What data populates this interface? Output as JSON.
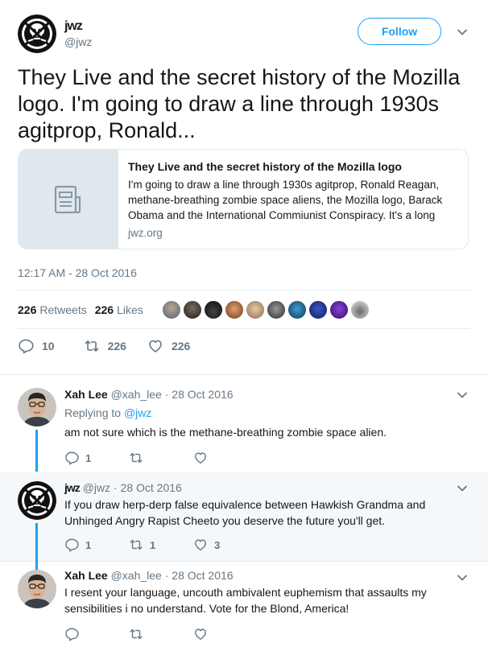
{
  "tweet": {
    "author_name": "jwz",
    "author_handle": "@jwz",
    "follow_label": "Follow",
    "text": "They Live and the secret history of the Mozilla logo. I'm going to draw a line through 1930s agitprop, Ronald...",
    "card": {
      "title": "They Live and the secret history of the Mozilla logo",
      "description": "I'm going to draw a line through 1930s agitprop, Ronald Reagan, methane-breathing zombie space aliens, the Mozilla logo, Barack Obama and the International Commiunist Conspiracy. It's a long",
      "domain": "jwz.org"
    },
    "timestamp": "12:17 AM - 28 Oct 2016",
    "retweets_count": "226",
    "retweets_label": "Retweets",
    "likes_count": "226",
    "likes_label": "Likes",
    "actions": {
      "replies": "10",
      "retweets": "226",
      "likes": "226"
    }
  },
  "replies": [
    {
      "name": "Xah Lee",
      "handle": "@xah_lee",
      "date": "· 28 Oct 2016",
      "replying_prefix": "Replying to",
      "replying_to": "@jwz",
      "text": "am not sure which is the methane-breathing zombie space alien.",
      "replies": "1",
      "retweets": "",
      "likes": ""
    },
    {
      "name": "jwz",
      "handle": "@jwz",
      "date": "· 28 Oct 2016",
      "text": "If you draw herp-derp false equivalence between Hawkish Grandma and Unhinged Angry Rapist Cheeto you deserve the future you'll get.",
      "replies": "1",
      "retweets": "1",
      "likes": "3"
    },
    {
      "name": "Xah Lee",
      "handle": "@xah_lee",
      "date": "· 28 Oct 2016",
      "text": "I resent your language, uncouth ambivalent euphemism that assaults my sensibilities i no understand. Vote for the Blond, America!",
      "replies": "",
      "retweets": "",
      "likes": ""
    }
  ],
  "colors": {
    "accent": "#1da1f2",
    "muted": "#657786",
    "text": "#14171a",
    "border": "#e6ecf0",
    "highlight_bg": "#f5f8fa"
  },
  "icons": {
    "reply": "reply-icon",
    "retweet": "retweet-icon",
    "like": "heart-icon",
    "caret": "chevron-down-icon",
    "card": "document-icon"
  }
}
